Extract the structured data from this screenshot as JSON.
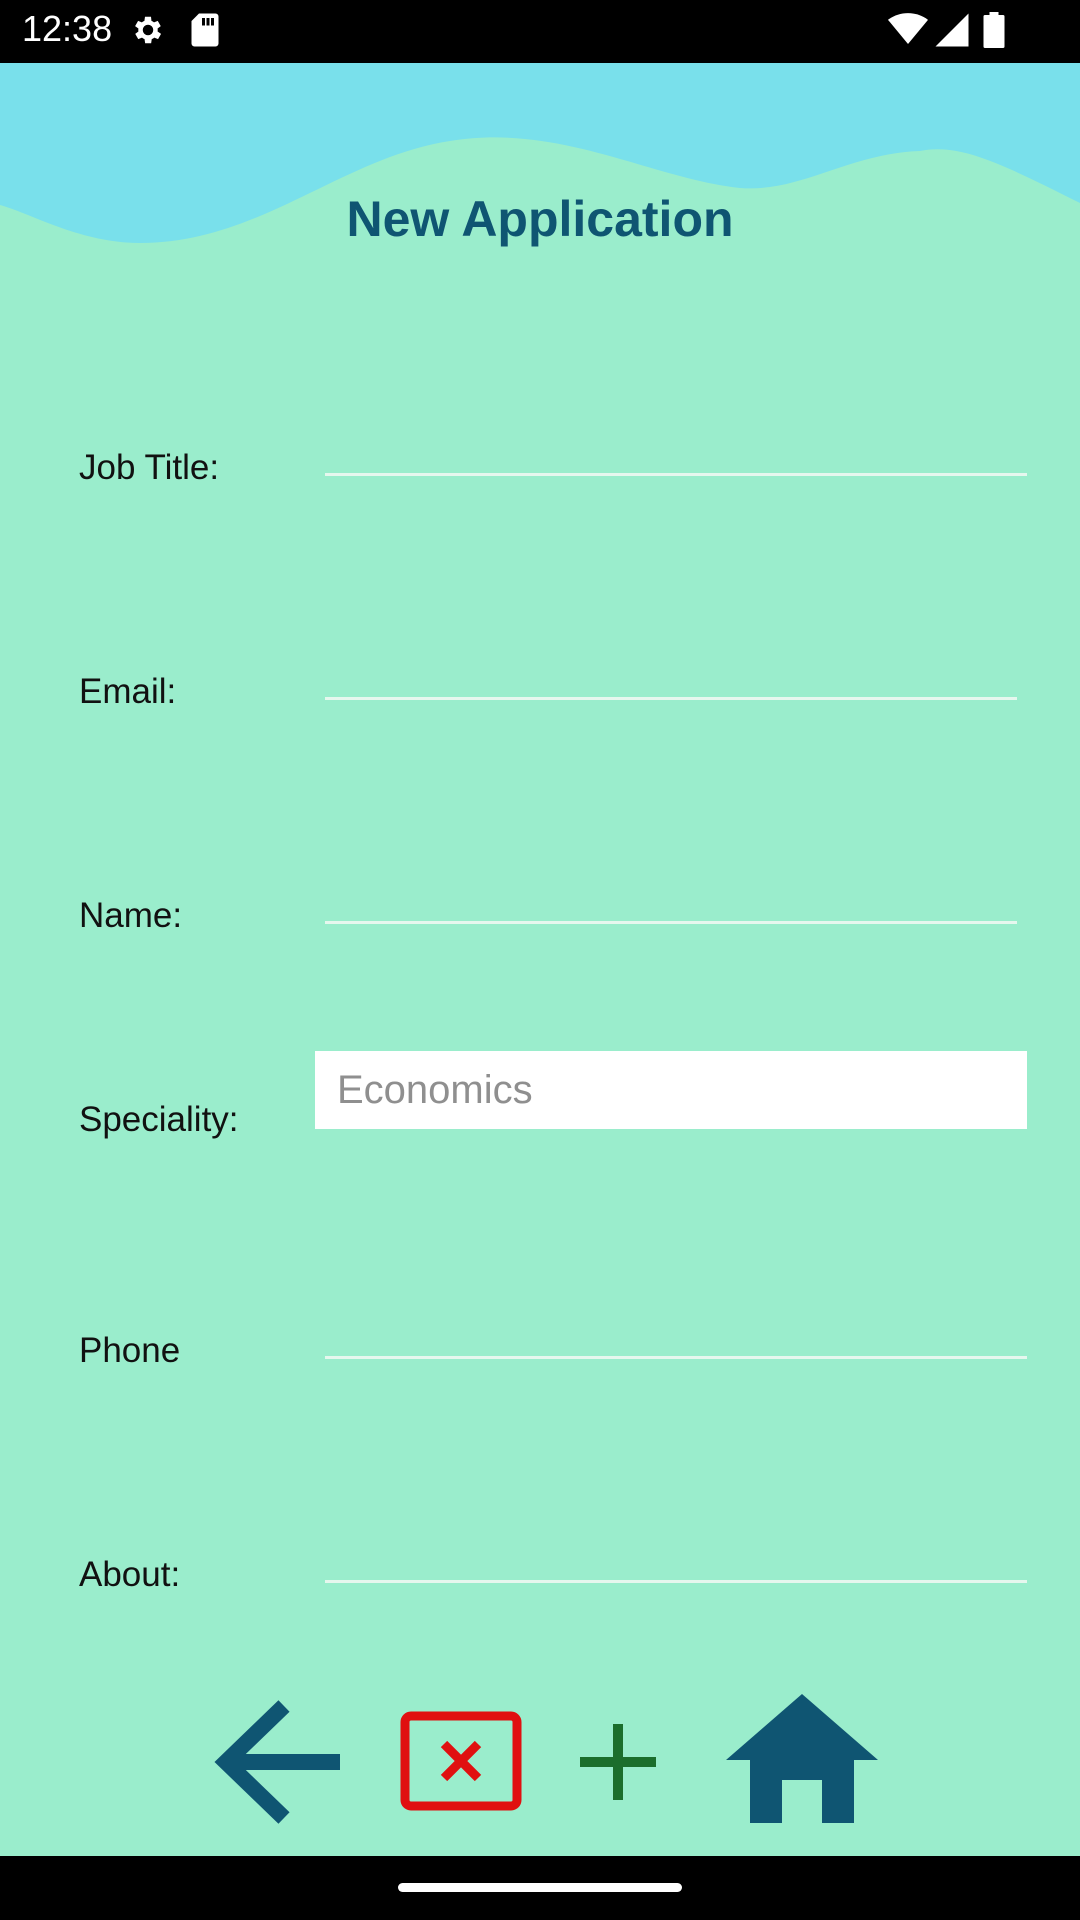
{
  "status_bar": {
    "time": "12:38",
    "icons": [
      "settings-icon",
      "sd-card-icon",
      "wifi-icon",
      "signal-icon",
      "battery-icon"
    ]
  },
  "header": {
    "title": "New Application"
  },
  "form": {
    "job_title_label": "Job Title:",
    "email_label": "Email:",
    "name_label": "Name:",
    "speciality_label": "Speciality:",
    "speciality_value": "Economics",
    "phone_label": "Phone",
    "about_label": "About:"
  },
  "actions": {
    "back": "back-arrow-icon",
    "cancel": "cancel-x-icon",
    "add": "add-plus-icon",
    "home": "home-icon"
  },
  "colors": {
    "background": "#9AEDCC",
    "header_wave": "#79E0EB",
    "title": "#0F5572",
    "cancel": "#E01010",
    "add": "#1B6E2C",
    "nav_icon": "#0F5572"
  }
}
